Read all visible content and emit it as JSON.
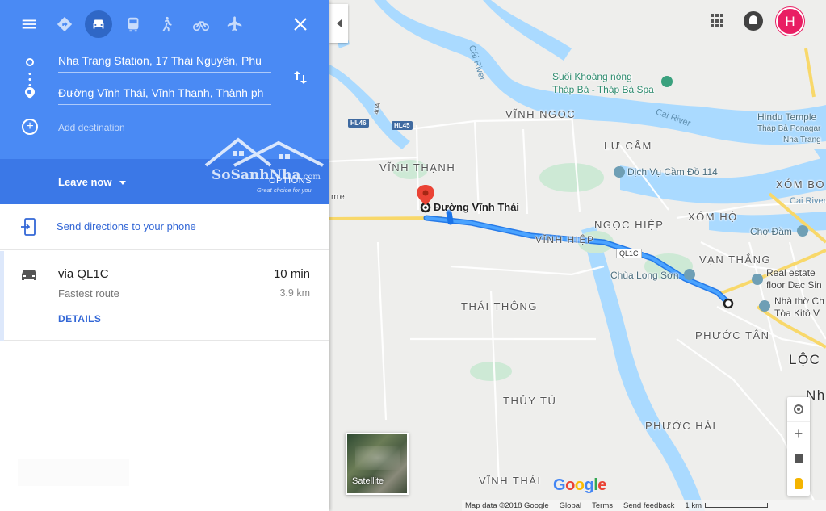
{
  "header": {
    "modes": [
      "best-route",
      "driving",
      "transit",
      "walking",
      "cycling",
      "flights"
    ],
    "active_mode": "driving"
  },
  "directions": {
    "origin": "Nha Trang Station, 17 Thái Nguyên, Phu",
    "destination": "Đường Vĩnh Thái, Vĩnh Thạnh, Thành ph",
    "add_destination_placeholder": "Add destination",
    "leave_now": "Leave now",
    "options": "OPTIONS"
  },
  "watermark": {
    "name": "SoSanhNha",
    "domain": ".com",
    "tagline": "Great choice for you"
  },
  "send_to_phone": "Send directions to your phone",
  "routes": [
    {
      "via": "via QL1C",
      "subtitle": "Fastest route",
      "time": "10 min",
      "distance": "3.9 km",
      "details": "DETAILS"
    }
  ],
  "map": {
    "labels": {
      "vinh_ngoc": "VĨNH NGỌC",
      "vinh_thanh": "VĨNH THẠNH",
      "luu_cam": "LƯ CẤM",
      "xom_bong": "XÓM BO",
      "xom_ho": "XÓM HỘ",
      "ngoc_hiep": "NGỌC HIỆP",
      "vinh_hiep": "VĨNH HIỆP",
      "van_thang": "VẠN THẮNG",
      "thai_thong": "THÁI THÔNG",
      "phuoc_tan": "PHƯỚC TÂN",
      "loc": "LỘC",
      "thuy_tu": "THỦY TÚ",
      "phuoc_hai": "PHƯỚC HẢI",
      "vinh_thai": "VĨNH THÁI",
      "nha": "Nh",
      "me": "me"
    },
    "rivers": {
      "cai_left": "Cái River",
      "cai_right": "Cai River",
      "cai_far": "Cai River"
    },
    "pois": {
      "suoi_khoang": "Suối Khoáng nóng",
      "thap_ba": "Tháp Bà - Tháp Bà Spa",
      "hindu_temple": "Hindu Temple",
      "thap_ba_ponagar": "Tháp Bà Ponagar",
      "nha_trang": "Nha Trang",
      "dich_vu": "Dịch Vụ Cầm Đồ 114",
      "cho_dam": "Chợ Đầm",
      "chua_long_son": "Chùa Long Sơn",
      "real_estate": "Real estate",
      "floor_dac_sin": "floor Dac Sin",
      "nha_tho": "Nhà thờ Ch",
      "toa_kito": "Tòa Kitô V"
    },
    "roads": {
      "hl46": "HL46",
      "hl45": "HL45",
      "r40a": "40A",
      "ql1c": "QL1C"
    },
    "destination_label": "Đường Vĩnh Thái",
    "satellite": "Satellite",
    "google_logo": [
      "G",
      "o",
      "o",
      "g",
      "l",
      "e"
    ],
    "footer": {
      "map_data": "Map data ©2018 Google",
      "global": "Global",
      "terms": "Terms",
      "feedback": "Send feedback",
      "scale": "1 km"
    },
    "profile_initial": "H",
    "colors": {
      "water": "#aadaff",
      "route": "#4285f4",
      "land": "#eeeeec",
      "header_blue": "#4a8af4",
      "avatar": "#e91e63"
    }
  }
}
